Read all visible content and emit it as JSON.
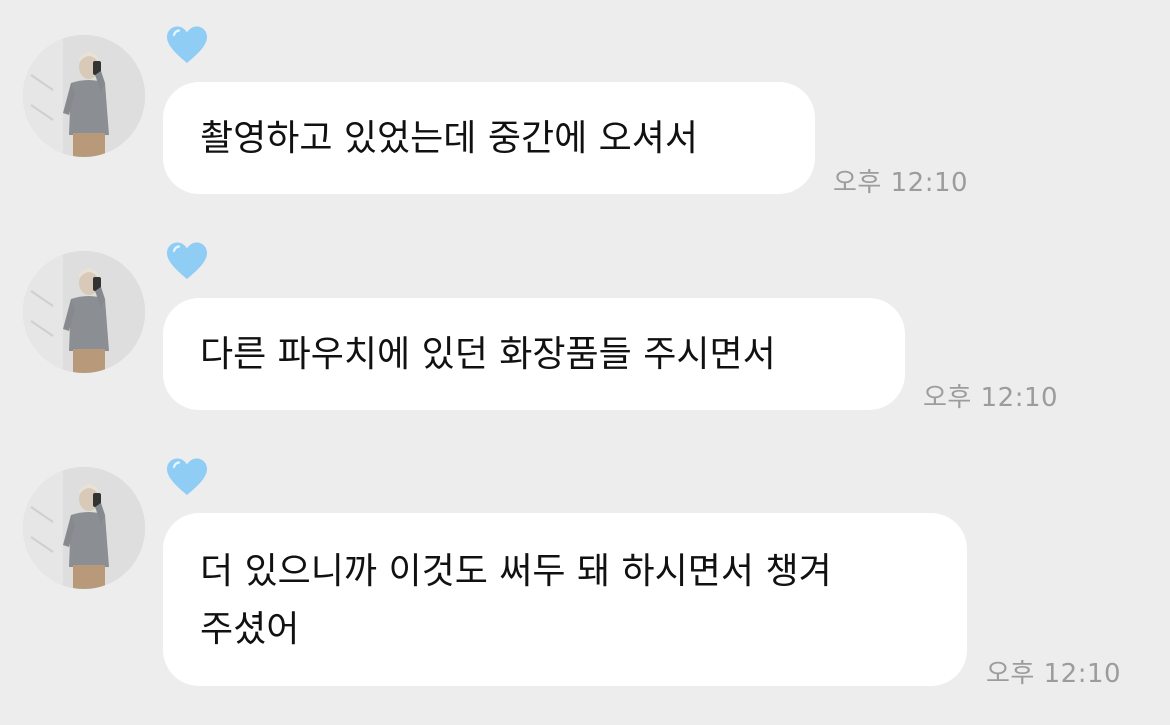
{
  "chat": {
    "accent_heart_color": "#8fcdf5",
    "messages": [
      {
        "lines": [
          "촬영하고 있었는데 중간에 오셔서"
        ],
        "time": "오후 12:10",
        "reaction_icon": "heart-icon"
      },
      {
        "lines": [
          "다른 파우치에 있던 화장품들 주시면서"
        ],
        "time": "오후 12:10",
        "reaction_icon": "heart-icon"
      },
      {
        "lines": [
          "더 있으니까 이것도 써두 돼 하시면서 챙겨",
          "주셨어"
        ],
        "time": "오후 12:10",
        "reaction_icon": "heart-icon"
      }
    ]
  }
}
